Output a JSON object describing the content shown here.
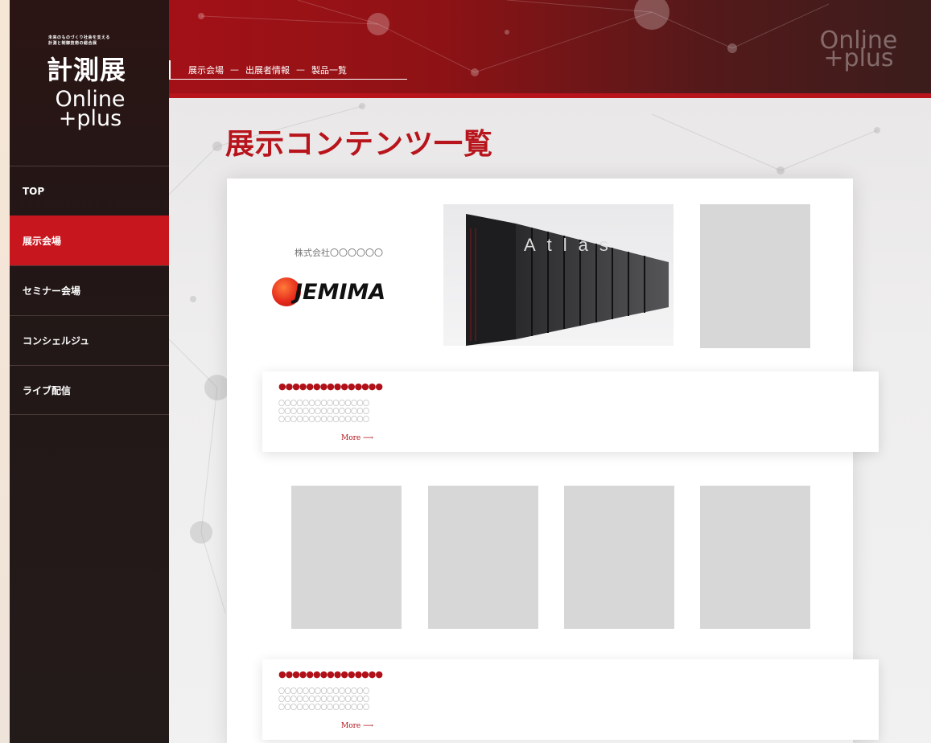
{
  "logo": {
    "tagline_line1": "未来のものづくり社会を支える",
    "tagline_line2": "計測と制御技術の総合展",
    "title": "計測展",
    "online_line1": "Online",
    "online_line2": "+plus"
  },
  "nav": {
    "items": [
      {
        "label": "TOP",
        "active": false
      },
      {
        "label": "展示会場",
        "active": true
      },
      {
        "label": "セミナー会場",
        "active": false
      },
      {
        "label": "コンシェルジュ",
        "active": false
      },
      {
        "label": "ライブ配信",
        "active": false
      }
    ]
  },
  "breadcrumb": {
    "items": [
      "展示会場",
      "出展者情報",
      "製品一覧"
    ],
    "separator": "—"
  },
  "header": {
    "watermark_line1": "Online",
    "watermark_line2": "+plus"
  },
  "page": {
    "title": "展示コンテンツ一覧"
  },
  "exhibitor": {
    "company_name": "株式会社〇〇〇〇〇〇",
    "logo_text": "JEMIMA",
    "hero_image_text": "Atlas"
  },
  "sections": [
    {
      "title": "●●●●●●●●●●●●●●●",
      "lines": [
        "〇〇〇〇〇〇〇〇〇〇〇〇〇〇〇",
        "〇〇〇〇〇〇〇〇〇〇〇〇〇〇〇",
        "〇〇〇〇〇〇〇〇〇〇〇〇〇〇〇"
      ],
      "more": "More ⟶"
    },
    {
      "title": "●●●●●●●●●●●●●●●",
      "lines": [
        "〇〇〇〇〇〇〇〇〇〇〇〇〇〇〇",
        "〇〇〇〇〇〇〇〇〇〇〇〇〇〇〇",
        "〇〇〇〇〇〇〇〇〇〇〇〇〇〇〇"
      ],
      "more": "More ⟶"
    }
  ],
  "colors": {
    "accent": "#c8161e",
    "sidebar": "#221716",
    "title_red": "#b8141c"
  }
}
